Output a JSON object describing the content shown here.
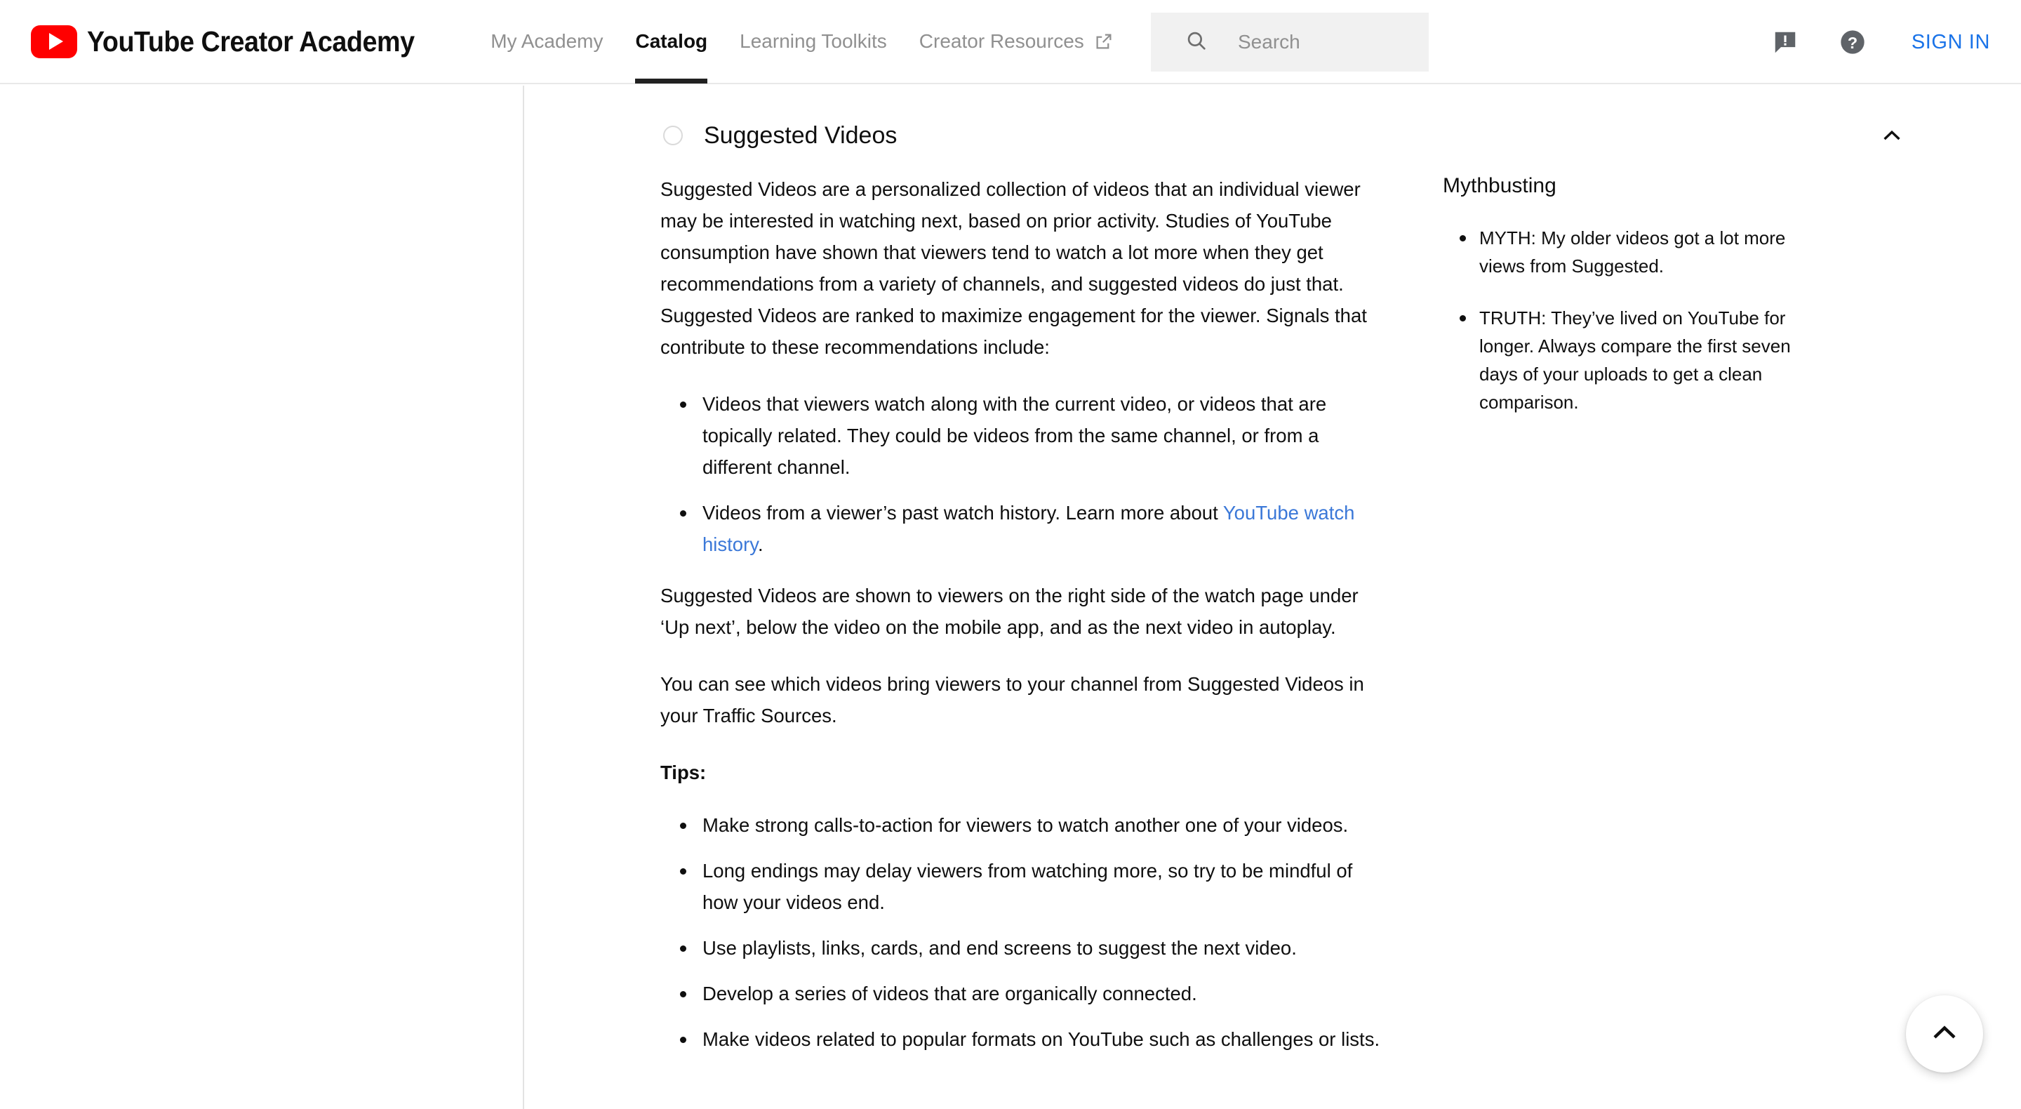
{
  "header": {
    "brand": "YouTube Creator Academy",
    "nav": [
      {
        "label": "My Academy",
        "active": false,
        "external": false
      },
      {
        "label": "Catalog",
        "active": true,
        "external": false
      },
      {
        "label": "Learning Toolkits",
        "active": false,
        "external": false
      },
      {
        "label": "Creator Resources",
        "active": false,
        "external": true
      }
    ],
    "search": {
      "placeholder": "Search",
      "value": ""
    },
    "sign_in": "SIGN IN",
    "icons": {
      "search": "search-icon",
      "feedback": "feedback-icon",
      "help": "help-icon",
      "external": "open-in-new-icon"
    },
    "colors": {
      "brand_red": "#ff0000",
      "link_blue": "#1a73e8",
      "search_bg": "#f1f1f1"
    }
  },
  "section": {
    "title": "Suggested Videos",
    "toggle_state": "expanded",
    "toggle_icon": "chevron-up-icon",
    "progress_icon": "progress-circle-icon"
  },
  "main": {
    "intro_paragraph": "Suggested Videos are a personalized collection of videos that an individual viewer may be interested in watching next, based on prior activity. Studies of YouTube consumption have shown that viewers tend to watch a lot more when they get recommendations from a variety of channels, and suggested videos do just that. Suggested Videos are ranked to maximize engagement for the viewer. Signals that contribute to these recommendations include:",
    "signal_bullet_1": "Videos that viewers watch along with the current video, or videos that are topically related. They could be videos from the same channel, or from a different channel.",
    "signal_bullet_2_before": "Videos from a viewer’s past watch history. Learn more about ",
    "signal_bullet_2_link": "YouTube watch history",
    "signal_bullet_2_after": ".",
    "paragraph_2": "Suggested Videos are shown to viewers on the right side of the watch page under ‘Up next’, below the video on the mobile app, and as the next video in autoplay.",
    "paragraph_3": "You can see which videos bring viewers to your channel from Suggested Videos in your Traffic Sources.",
    "tips_label": "Tips:",
    "tips": [
      "Make strong calls-to-action for viewers to watch another one of your videos.",
      "Long endings may delay viewers from watching more, so try to be mindful of how your videos end.",
      "Use playlists, links, cards, and end screens to suggest the next video.",
      "Develop a series of videos that are organically connected.",
      "Make videos related to popular formats on YouTube such as challenges or lists."
    ]
  },
  "sidebar": {
    "title": "Mythbusting",
    "items": [
      "MYTH: My older videos got a lot more views from Suggested.",
      "TRUTH: They’ve lived on YouTube for longer. Always compare the first seven days of your uploads to get a clean comparison."
    ]
  },
  "scroll_top": {
    "icon": "chevron-up-icon",
    "label": "Back to top"
  }
}
